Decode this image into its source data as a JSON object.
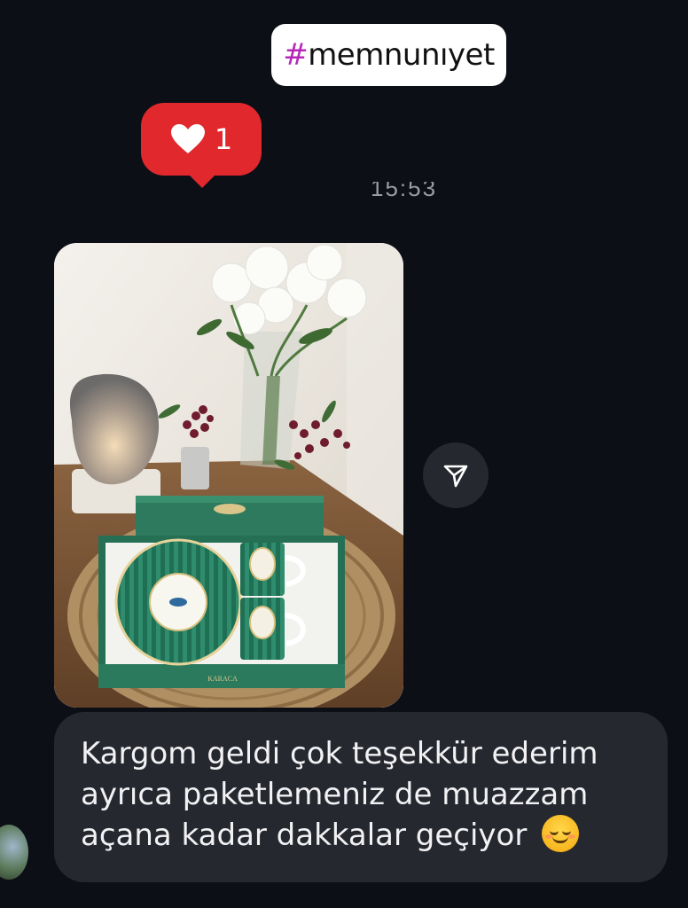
{
  "hashtag_sticker": {
    "hash": "#",
    "word": "memnunıyet"
  },
  "like_reaction": {
    "count": "1",
    "icon": "heart-icon"
  },
  "timestamp": "15:53",
  "message_photo": {
    "description_icon": "product-photo",
    "brand_label": "KARACA"
  },
  "share_button": {
    "icon": "send-icon"
  },
  "message_text": {
    "line1": "Kargom geldi çok teşekkür ederim",
    "line2": "ayrıca paketlemeniz de muazzam",
    "line3": "açana kadar dakkalar geçiyor",
    "emoji": "smiling-face-emoji"
  },
  "colors": {
    "background": "#0d0f17",
    "bubble": "#26282f",
    "like_red": "#e0282d",
    "hashtag_purple": "#b626b7"
  }
}
